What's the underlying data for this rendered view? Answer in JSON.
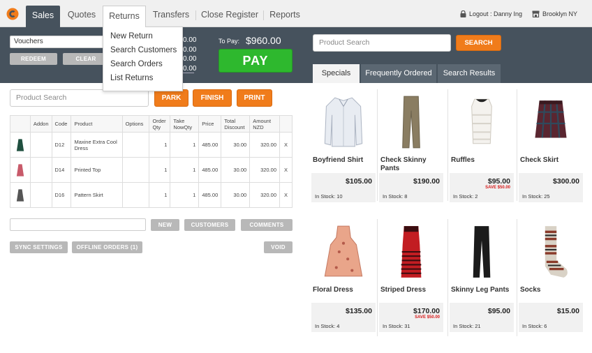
{
  "nav": {
    "tabs": [
      "Sales",
      "Quotes",
      "Returns",
      "Transfers",
      "Close Register",
      "Reports"
    ],
    "logout": "Logout : Danny Ing",
    "store": "Brooklyn NY"
  },
  "returns_menu": [
    "New Return",
    "Search Customers",
    "Search Orders",
    "List Returns"
  ],
  "voucher": {
    "value": "Vouchers",
    "redeem": "REDEEM",
    "clear": "CLEAR"
  },
  "totals_partial": [
    "0.00",
    "0.00",
    "0.00",
    "0.00"
  ],
  "to_pay": {
    "label": "To Pay:",
    "value": "$960.00",
    "pay": "PAY"
  },
  "search_right": {
    "placeholder": "Product Search",
    "button": "SEARCH"
  },
  "right_tabs": [
    "Specials",
    "Frequently Ordered",
    "Search Results"
  ],
  "left": {
    "search_placeholder": "Product Search",
    "park": "PARK",
    "finish": "FINISH",
    "print": "PRINT",
    "new": "NEW",
    "customers": "CUSTOMERS",
    "comments": "COMMENTS",
    "sync": "SYNC SETTINGS",
    "offline": "OFFLINE ORDERS (1)",
    "void": "VOID"
  },
  "cart": {
    "headers": [
      "",
      "Addon",
      "Code",
      "Product",
      "Options",
      "Order Qty",
      "Take NowQty",
      "Price",
      "Total Discount",
      "Amount NZD",
      ""
    ],
    "rows": [
      {
        "code": "D12",
        "product": "Maxine Extra Cool Dress",
        "options": "",
        "order_qty": "1",
        "take_now": "1",
        "price": "485.00",
        "discount": "30.00",
        "amount": "320.00",
        "remove": "X",
        "color": "#1f4f3f"
      },
      {
        "code": "D14",
        "product": "Printed Top",
        "options": "",
        "order_qty": "1",
        "take_now": "1",
        "price": "485.00",
        "discount": "30.00",
        "amount": "320.00",
        "remove": "X",
        "color": "#c85a6a"
      },
      {
        "code": "D16",
        "product": "Pattern Skirt",
        "options": "",
        "order_qty": "1",
        "take_now": "1",
        "price": "485.00",
        "discount": "30.00",
        "amount": "320.00",
        "remove": "X",
        "color": "#555555"
      }
    ]
  },
  "products": [
    {
      "name": "Boyfriend Shirt",
      "price": "$105.00",
      "save": "",
      "stock": "In Stock: 10",
      "icon": "shirt"
    },
    {
      "name": "Check Skinny Pants",
      "price": "$190.00",
      "save": "",
      "stock": "In Stock: 8",
      "icon": "pants-khaki"
    },
    {
      "name": "Ruffles",
      "price": "$95.00",
      "save": "SAVE $50.00",
      "stock": "In Stock: 2",
      "icon": "ruffle-top"
    },
    {
      "name": "Check Skirt",
      "price": "$300.00",
      "save": "",
      "stock": "In Stock: 25",
      "icon": "check-skirt"
    },
    {
      "name": "Floral Dress",
      "price": "$135.00",
      "save": "",
      "stock": "In Stock: 4",
      "icon": "floral-dress"
    },
    {
      "name": "Striped Dress",
      "price": "$170.00",
      "save": "SAVE $50.00",
      "stock": "In Stock: 31",
      "icon": "striped-dress"
    },
    {
      "name": "Skinny Leg Pants",
      "price": "$95.00",
      "save": "",
      "stock": "In Stock: 21",
      "icon": "black-pants"
    },
    {
      "name": "Socks",
      "price": "$15.00",
      "save": "",
      "stock": "In Stock: 6",
      "icon": "socks"
    }
  ],
  "colors": {
    "nav_dark": "#46525d",
    "accent_orange": "#f07c1b",
    "pay_green": "#2eb82e",
    "save_red": "#d61a1a"
  }
}
